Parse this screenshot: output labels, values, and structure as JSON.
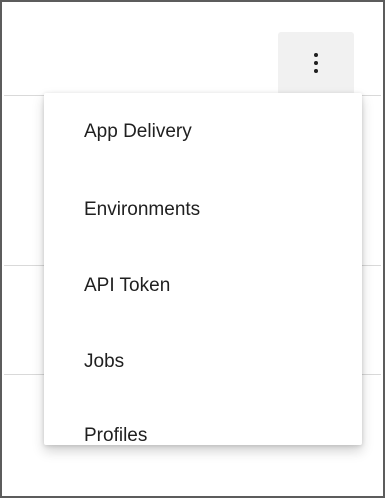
{
  "toolbar": {
    "more_icon": "more-vert-icon"
  },
  "menu": {
    "items": [
      {
        "label": "App Delivery"
      },
      {
        "label": "Environments"
      },
      {
        "label": "API Token"
      },
      {
        "label": "Jobs"
      },
      {
        "label": "Profiles"
      }
    ]
  },
  "colors": {
    "frame_border": "#5c5c5c",
    "button_bg": "#f1f1f1",
    "text": "#202020",
    "divider": "#d9d9d9"
  }
}
